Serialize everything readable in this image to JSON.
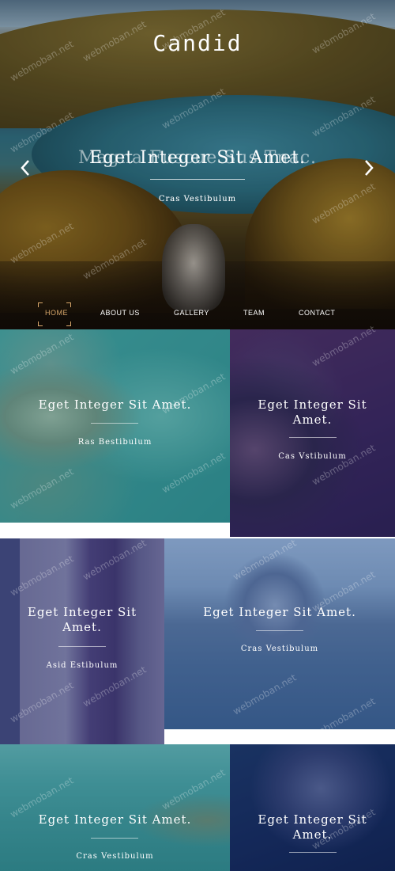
{
  "site": {
    "brand": "Candid"
  },
  "slider": {
    "title": "Eget Integer Sit Amet.",
    "title_ghost": "Magna Fuscue Sus Tnac.",
    "subtitle": "Cras Vestibulum",
    "subtitle_ghost": "Cras Vestibulum",
    "prev_icon": "chevron-left-icon",
    "next_icon": "chevron-right-icon"
  },
  "nav": {
    "items": [
      {
        "label": "HOME",
        "active": true
      },
      {
        "label": "ABOUT US",
        "active": false
      },
      {
        "label": "GALLERY",
        "active": false
      },
      {
        "label": "TEAM",
        "active": false
      },
      {
        "label": "CONTACT",
        "active": false
      }
    ],
    "active_color": "#d8a76b"
  },
  "gallery": {
    "tiles": [
      {
        "title": "Eget Integer Sit Amet.",
        "subtitle": "Ras Bestibulum"
      },
      {
        "title": "Eget Integer Sit Amet.",
        "subtitle": "Cas Vstibulum"
      },
      {
        "title": "Eget Integer Sit Amet.",
        "subtitle": "Asid Estibulum"
      },
      {
        "title": "Eget Integer Sit Amet.",
        "subtitle": "Cras Vestibulum"
      },
      {
        "title": "Eget Integer Sit Amet.",
        "subtitle": "Cras Vestibulum"
      },
      {
        "title": "Eget Integer Sit Amet.",
        "subtitle": ""
      }
    ]
  },
  "watermark": {
    "text": "webmoban.net"
  }
}
